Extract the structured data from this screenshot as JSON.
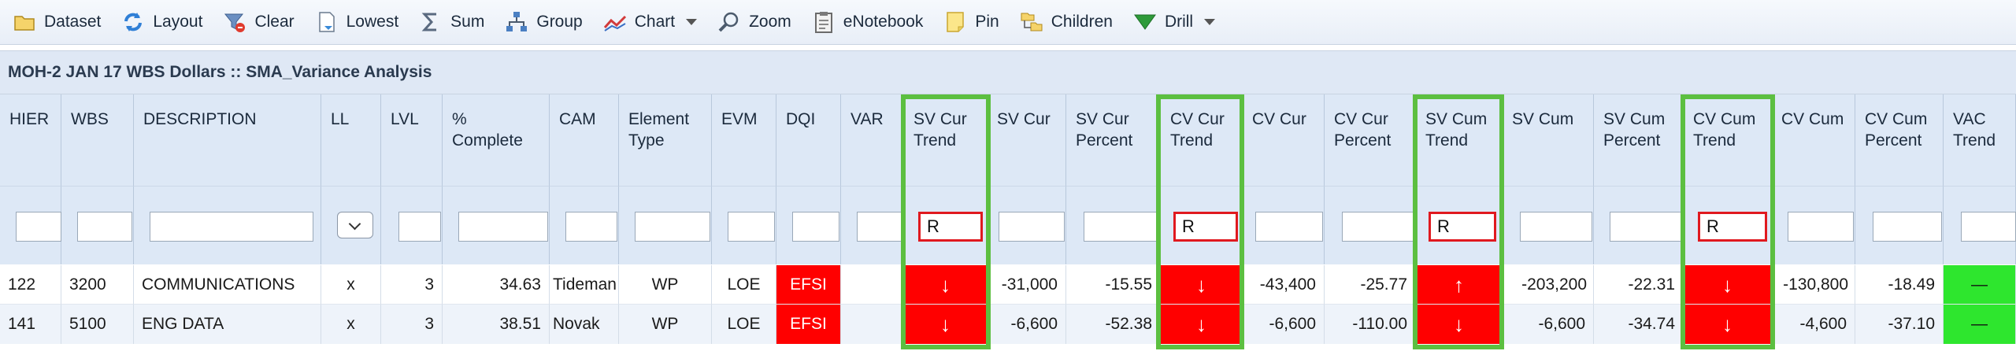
{
  "toolbar": {
    "items": [
      {
        "label": "Dataset",
        "icon": "folder-icon"
      },
      {
        "label": "Layout",
        "icon": "refresh-icon"
      },
      {
        "label": "Clear",
        "icon": "filter-clear-icon"
      },
      {
        "label": "Lowest",
        "icon": "document-icon"
      },
      {
        "label": "Sum",
        "icon": "sigma-icon"
      },
      {
        "label": "Group",
        "icon": "hierarchy-icon"
      },
      {
        "label": "Chart",
        "icon": "line-chart-icon"
      },
      {
        "label": "Zoom",
        "icon": "magnifier-icon"
      },
      {
        "label": "eNotebook",
        "icon": "clipboard-icon"
      },
      {
        "label": "Pin",
        "icon": "note-icon"
      },
      {
        "label": "Children",
        "icon": "folder-tree-icon"
      },
      {
        "label": "Drill",
        "icon": "funnel-icon"
      }
    ]
  },
  "report": {
    "title": "MOH-2 JAN 17 WBS Dollars :: SMA_Variance Analysis"
  },
  "columns": {
    "hier": {
      "line1": "HIER",
      "line2": ""
    },
    "wbs": {
      "line1": "WBS",
      "line2": ""
    },
    "description": {
      "line1": "DESCRIPTION",
      "line2": ""
    },
    "ll": {
      "line1": "LL",
      "line2": ""
    },
    "lvl": {
      "line1": "LVL",
      "line2": ""
    },
    "pct_complete": {
      "line1": "%",
      "line2": "Complete"
    },
    "cam": {
      "line1": "CAM",
      "line2": ""
    },
    "element_type": {
      "line1": "Element",
      "line2": "Type"
    },
    "evm": {
      "line1": "EVM",
      "line2": ""
    },
    "dqi": {
      "line1": "DQI",
      "line2": ""
    },
    "var": {
      "line1": "VAR",
      "line2": ""
    },
    "sv_cur_trend": {
      "line1": "SV Cur",
      "line2": "Trend"
    },
    "sv_cur": {
      "line1": "SV Cur",
      "line2": ""
    },
    "sv_cur_percent": {
      "line1": "SV Cur",
      "line2": "Percent"
    },
    "cv_cur_trend": {
      "line1": "CV Cur",
      "line2": "Trend"
    },
    "cv_cur": {
      "line1": "CV Cur",
      "line2": ""
    },
    "cv_cur_percent": {
      "line1": "CV Cur",
      "line2": "Percent"
    },
    "sv_cum_trend": {
      "line1": "SV Cum",
      "line2": "Trend"
    },
    "sv_cum": {
      "line1": "SV Cum",
      "line2": ""
    },
    "sv_cum_percent": {
      "line1": "SV Cum",
      "line2": "Percent"
    },
    "cv_cum_trend": {
      "line1": "CV Cum",
      "line2": "Trend"
    },
    "cv_cum": {
      "line1": "CV Cum",
      "line2": ""
    },
    "cv_cum_percent": {
      "line1": "CV Cum",
      "line2": "Percent"
    },
    "vac_trend": {
      "line1": "VAC",
      "line2": "Trend"
    }
  },
  "filters": {
    "sv_cur_trend": "R",
    "cv_cur_trend": "R",
    "sv_cum_trend": "R",
    "cv_cum_trend": "R"
  },
  "rows": [
    {
      "hier": "122",
      "wbs": "3200",
      "description": "COMMUNICATIONS",
      "ll": "x",
      "lvl": "3",
      "pct_complete": "34.63",
      "cam": "Tideman",
      "element_type": "WP",
      "evm": "LOE",
      "dqi": "EFSI",
      "var": "",
      "sv_cur_trend": "↓",
      "sv_cur": "-31,000",
      "sv_cur_percent": "-15.55",
      "cv_cur_trend": "↓",
      "cv_cur": "-43,400",
      "cv_cur_percent": "-25.77",
      "sv_cum_trend": "↑",
      "sv_cum": "-203,200",
      "sv_cum_percent": "-22.31",
      "cv_cum_trend": "↓",
      "cv_cum": "-130,800",
      "cv_cum_percent": "-18.49",
      "vac_trend": "—"
    },
    {
      "hier": "141",
      "wbs": "5100",
      "description": "ENG DATA",
      "ll": "x",
      "lvl": "3",
      "pct_complete": "38.51",
      "cam": "Novak",
      "element_type": "WP",
      "evm": "LOE",
      "dqi": "EFSI",
      "var": "",
      "sv_cur_trend": "↓",
      "sv_cur": "-6,600",
      "sv_cur_percent": "-52.38",
      "cv_cur_trend": "↓",
      "cv_cur": "-6,600",
      "cv_cur_percent": "-110.00",
      "sv_cum_trend": "↓",
      "sv_cum": "-6,600",
      "sv_cum_percent": "-34.74",
      "cv_cum_trend": "↓",
      "cv_cum": "-4,600",
      "cv_cum_percent": "-37.10",
      "vac_trend": "—"
    }
  ],
  "colors": {
    "alert_red": "#ff0000",
    "ok_green": "#2ee62e",
    "highlight_green": "#5cbf40",
    "filter_red_border": "#e0191f",
    "header_bg": "#dde8f6"
  }
}
